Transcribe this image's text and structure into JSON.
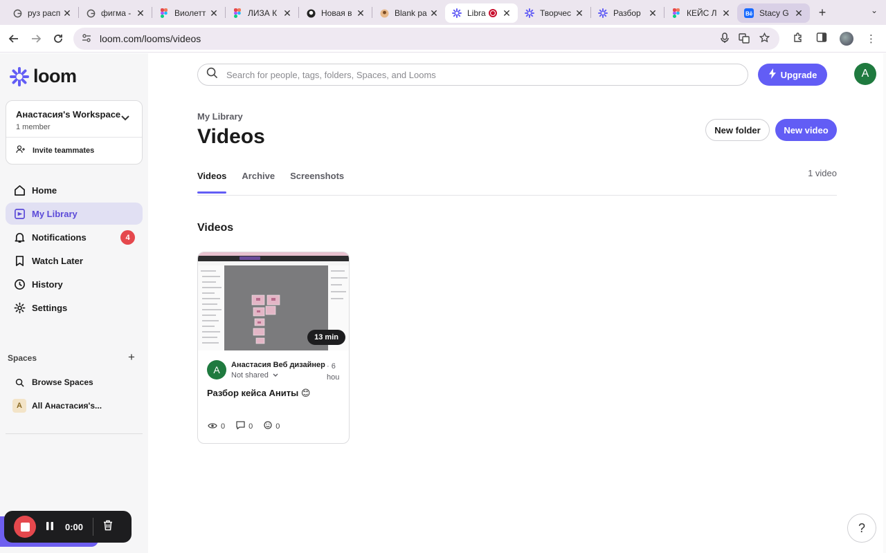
{
  "browser": {
    "tabs": [
      {
        "title": "руз расп",
        "icon": "google-g-icon"
      },
      {
        "title": "фигма -",
        "icon": "google-g-icon"
      },
      {
        "title": "Виолетт",
        "icon": "figma-icon"
      },
      {
        "title": "ЛИЗА К",
        "icon": "figma-icon"
      },
      {
        "title": "Новая в",
        "icon": "github-icon"
      },
      {
        "title": "Blank pa",
        "icon": "avatar-icon"
      },
      {
        "title": "Libra",
        "icon": "loom-icon",
        "recording": true
      },
      {
        "title": "Творчес",
        "icon": "loom-icon"
      },
      {
        "title": "Разбор",
        "icon": "loom-icon"
      },
      {
        "title": "КЕЙС Л",
        "icon": "figma-icon"
      },
      {
        "title": "Stacy G",
        "icon": "behance-icon"
      }
    ],
    "url": "loom.com/looms/videos"
  },
  "sidebar": {
    "logo_text": "loom",
    "workspace": {
      "name": "Анастасия's Workspace",
      "members": "1 member",
      "invite_label": "Invite teammates"
    },
    "nav": [
      {
        "label": "Home",
        "icon": "home-icon"
      },
      {
        "label": "My Library",
        "icon": "library-icon"
      },
      {
        "label": "Notifications",
        "icon": "bell-icon",
        "badge": "4"
      },
      {
        "label": "Watch Later",
        "icon": "bookmark-icon"
      },
      {
        "label": "History",
        "icon": "clock-icon"
      },
      {
        "label": "Settings",
        "icon": "gear-icon"
      }
    ],
    "spaces_heading": "Spaces",
    "spaces": [
      {
        "label": "Browse Spaces",
        "icon": "search-icon"
      },
      {
        "label": "All Анастасия's...",
        "avatar": "A"
      }
    ]
  },
  "recorder": {
    "timer": "0:00"
  },
  "main": {
    "search_placeholder": "Search for people, tags, folders, Spaces, and Looms",
    "upgrade_label": "Upgrade",
    "user_initial": "A",
    "breadcrumb": "My Library",
    "title": "Videos",
    "new_folder_label": "New folder",
    "new_video_label": "New video",
    "tabs": [
      "Videos",
      "Archive",
      "Screenshots"
    ],
    "video_count": "1 video",
    "section_heading": "Videos",
    "videos": [
      {
        "duration": "13 min",
        "author_initial": "A",
        "author": "Анастасия Веб дизайнер",
        "time_ago_1": "6",
        "time_ago_2": "hou",
        "sharing": "Not shared",
        "title": "Разбор кейса Аниты 😊",
        "views": "0",
        "comments": "0",
        "reactions": "0"
      }
    ]
  },
  "colors": {
    "accent": "#625df5",
    "badge": "#e5484d",
    "avatar": "#1f7a3f"
  }
}
